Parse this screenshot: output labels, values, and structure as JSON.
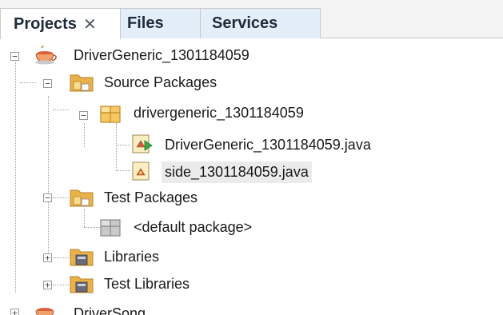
{
  "tabs": [
    {
      "label": "Projects",
      "close": "✕"
    },
    {
      "label": "Files"
    },
    {
      "label": "Services"
    }
  ],
  "tree": {
    "project": "DriverGeneric_1301184059",
    "source_packages": "Source Packages",
    "package": "drivergeneric_1301184059",
    "file_main": "DriverGeneric_1301184059.java",
    "file_side": "side_1301184059.java",
    "test_packages": "Test Packages",
    "default_package": "<default package>",
    "libraries": "Libraries",
    "test_libraries": "Test Libraries",
    "next_project": "DriverSong"
  },
  "colors": {
    "folder": "#e8b14a",
    "package": "#f0b23a",
    "java_file": "#f2e0a4",
    "selected_row": "#ebebeb"
  }
}
